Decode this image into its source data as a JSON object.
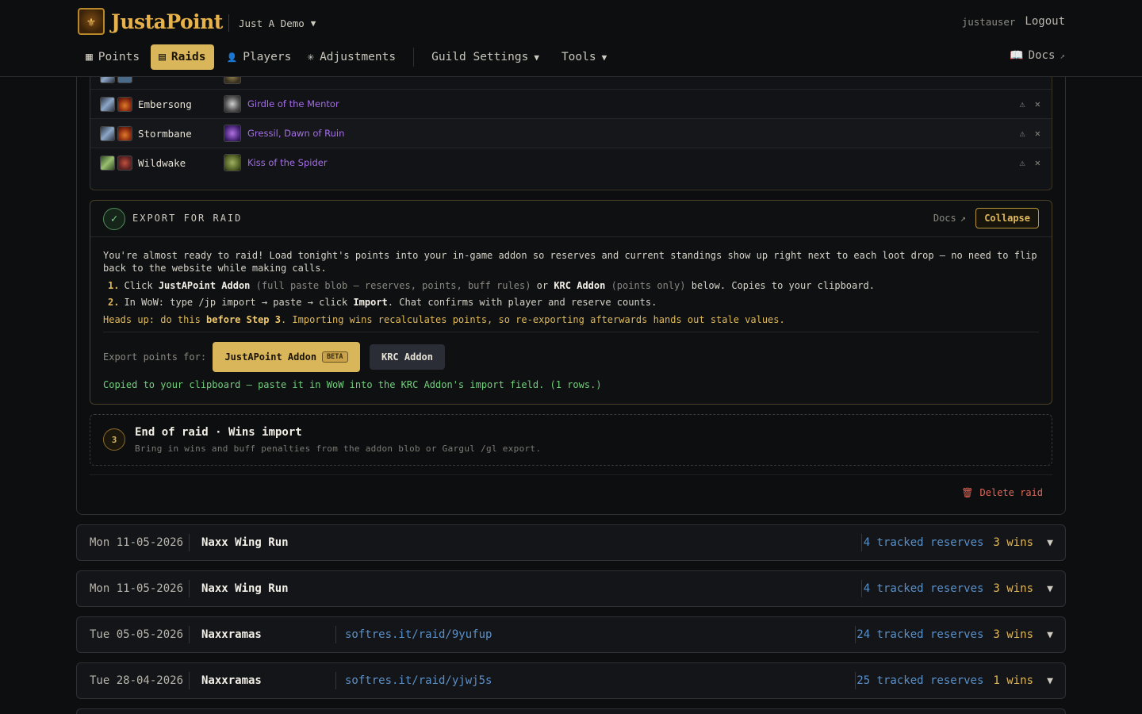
{
  "header": {
    "logo_text": "JustaPoint",
    "guild": "Just A Demo",
    "user": "justauser",
    "logout": "Logout"
  },
  "nav": {
    "points": "Points",
    "raids": "Raids",
    "players": "Players",
    "adjustments": "Adjustments",
    "guild_settings": "Guild Settings",
    "tools": "Tools",
    "docs": "Docs"
  },
  "loot": {
    "rows": [
      {
        "player": "Embersong",
        "item": "Girdle of the Mentor"
      },
      {
        "player": "Stormbane",
        "item": "Gressil, Dawn of Ruin"
      },
      {
        "player": "Wildwake",
        "item": "Kiss of the Spider"
      }
    ]
  },
  "export": {
    "title": "EXPORT FOR RAID",
    "docs": "Docs",
    "collapse": "Collapse",
    "intro": "You're almost ready to raid! Load tonight's points into your in-game addon so reserves and current standings show up right next to each loot drop — no need to flip back to the website while making calls.",
    "step1_num": "1.",
    "step1_a": "Click ",
    "step1_b": "JustAPoint Addon",
    "step1_c": " (full paste blob — reserves, points, buff rules)",
    "step1_d": " or ",
    "step1_e": "KRC Addon",
    "step1_f": " (points only)",
    "step1_g": " below. Copies to your clipboard.",
    "step2_num": "2.",
    "step2_a": "In WoW: type /jp import → paste → click ",
    "step2_b": "Import",
    "step2_c": ". Chat confirms with player and reserve counts.",
    "headsup_a": "Heads up: do this ",
    "headsup_b": "before Step 3",
    "headsup_c": ". Importing wins recalculates points, so re-exporting afterwards hands out stale values.",
    "export_for": "Export points for:",
    "btn_jp": "JustAPoint Addon",
    "beta": "BETA",
    "btn_krc": "KRC Addon",
    "copied": "Copied to your clipboard — paste it in WoW into the KRC Addon's import field. (1 rows.)"
  },
  "end_of_raid": {
    "num": "3",
    "title": "End of raid · Wins import",
    "subtitle": "Bring in wins and buff penalties from the addon blob or Gargul /gl export."
  },
  "delete_raid": "Delete raid",
  "raids": [
    {
      "date": "Mon 11-05-2026",
      "name": "Naxx Wing Run",
      "link": "",
      "reserves": "4 tracked reserves",
      "wins": "3 wins"
    },
    {
      "date": "Mon 11-05-2026",
      "name": "Naxx Wing Run",
      "link": "",
      "reserves": "4 tracked reserves",
      "wins": "3 wins"
    },
    {
      "date": "Tue 05-05-2026",
      "name": "Naxxramas",
      "link": "softres.it/raid/9yufup",
      "reserves": "24 tracked reserves",
      "wins": "3 wins"
    },
    {
      "date": "Tue 28-04-2026",
      "name": "Naxxramas",
      "link": "softres.it/raid/yjwj5s",
      "reserves": "25 tracked reserves",
      "wins": "1 wins"
    }
  ]
}
